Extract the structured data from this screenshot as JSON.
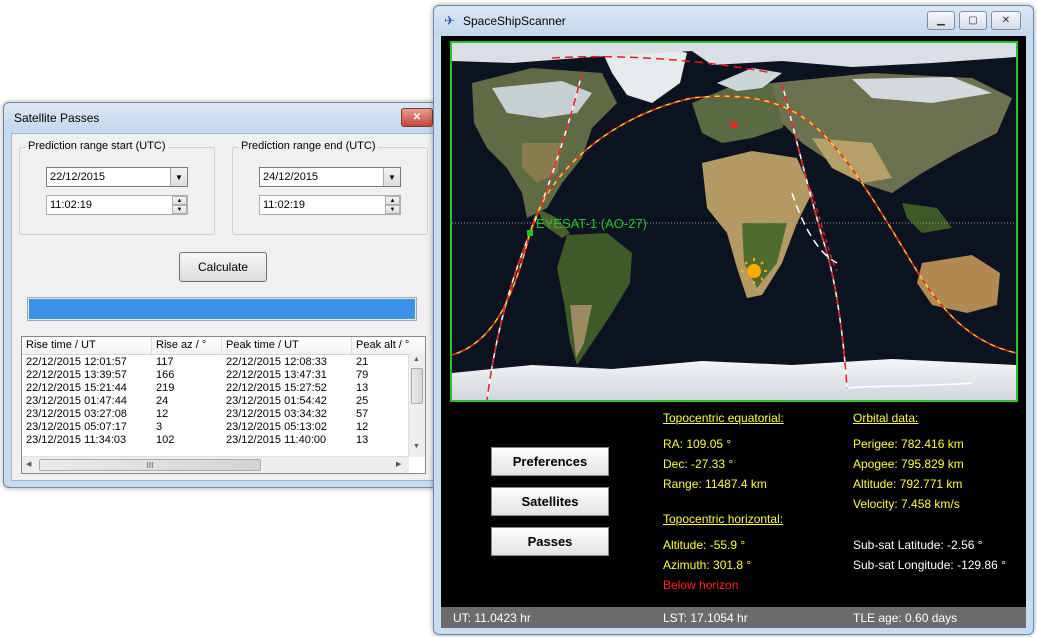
{
  "passes_window": {
    "title": "Satellite Passes",
    "start_group": {
      "label": "Prediction range start (UTC)",
      "date": "22/12/2015",
      "time": "11:02:19"
    },
    "end_group": {
      "label": "Prediction range end (UTC)",
      "date": "24/12/2015",
      "time": "11:02:19"
    },
    "calculate_label": "Calculate",
    "progress": 1.0,
    "table": {
      "columns": [
        "Rise time / UT",
        "Rise az / °",
        "Peak time / UT",
        "Peak alt / °"
      ],
      "rows": [
        [
          "22/12/2015 12:01:57",
          "117",
          "22/12/2015 12:08:33",
          "21"
        ],
        [
          "22/12/2015 13:39:57",
          "166",
          "22/12/2015 13:47:31",
          "79"
        ],
        [
          "22/12/2015 15:21:44",
          "219",
          "22/12/2015 15:27:52",
          "13"
        ],
        [
          "23/12/2015 01:47:44",
          "24",
          "23/12/2015 01:54:42",
          "25"
        ],
        [
          "23/12/2015 03:27:08",
          "12",
          "23/12/2015 03:34:32",
          "57"
        ],
        [
          "23/12/2015 05:07:17",
          "3",
          "23/12/2015 05:13:02",
          "12"
        ],
        [
          "23/12/2015 11:34:03",
          "102",
          "23/12/2015 11:40:00",
          "13"
        ]
      ],
      "scroll_grip": "III"
    }
  },
  "scanner_window": {
    "title": "SpaceShipScanner",
    "satellite_label": "EYESAT-1 (AO-27)",
    "buttons": {
      "preferences": "Preferences",
      "satellites": "Satellites",
      "passes": "Passes"
    },
    "topocentric_equatorial": {
      "heading": "Topocentric equatorial:",
      "ra": "RA: 109.05 °",
      "dec": "Dec: -27.33 °",
      "range": "Range: 11487.4 km"
    },
    "topocentric_horizontal": {
      "heading": "Topocentric horizontal:",
      "altitude": "Altitude: -55.9 °",
      "azimuth": "Azimuth: 301.8 °",
      "visibility": "Below horizon"
    },
    "orbital_data": {
      "heading": "Orbital data:",
      "perigee": "Perigee: 782.416 km",
      "apogee": "Apogee: 795.829 km",
      "altitude": "Altitude: 792.771 km",
      "velocity": "Velocity: 7.458 km/s",
      "subsat_latitude": "Sub-sat Latitude: -2.56 °",
      "subsat_longitude": "Sub-sat Longitude: -129.86 °"
    },
    "status": {
      "ut": "UT: 11.0423 hr",
      "lst": "LST: 17.1054 hr",
      "tle_age": "TLE age: 0.60 days"
    },
    "colors": {
      "map_border": "#22c522",
      "satellite_marker": "#22c522",
      "observer_marker": "#ff2020",
      "sun": "#ffaa00",
      "info_text": "#ffff33",
      "warning_text": "#ff2020"
    }
  }
}
